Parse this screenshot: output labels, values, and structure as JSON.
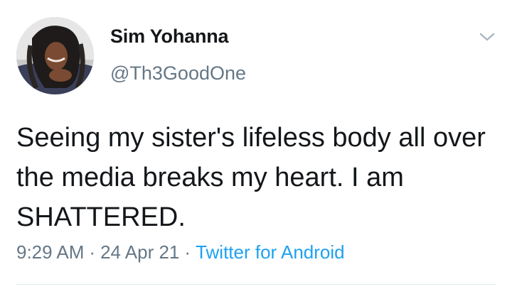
{
  "author": {
    "display_name": "Sim Yohanna",
    "handle": "@Th3GoodOne",
    "avatar_icon": "profile-photo"
  },
  "menu": {
    "icon": "chevron-down-icon"
  },
  "tweet": {
    "text": "Seeing my sister's lifeless body all over the media breaks my heart. I am SHATTERED.",
    "time": "9:29 AM",
    "separator": "·",
    "date": "24 Apr 21",
    "source": "Twitter for Android"
  },
  "colors": {
    "primary_text": "#14171a",
    "secondary_text": "#657786",
    "link": "#1da1f2",
    "divider": "#e1e8ed"
  }
}
